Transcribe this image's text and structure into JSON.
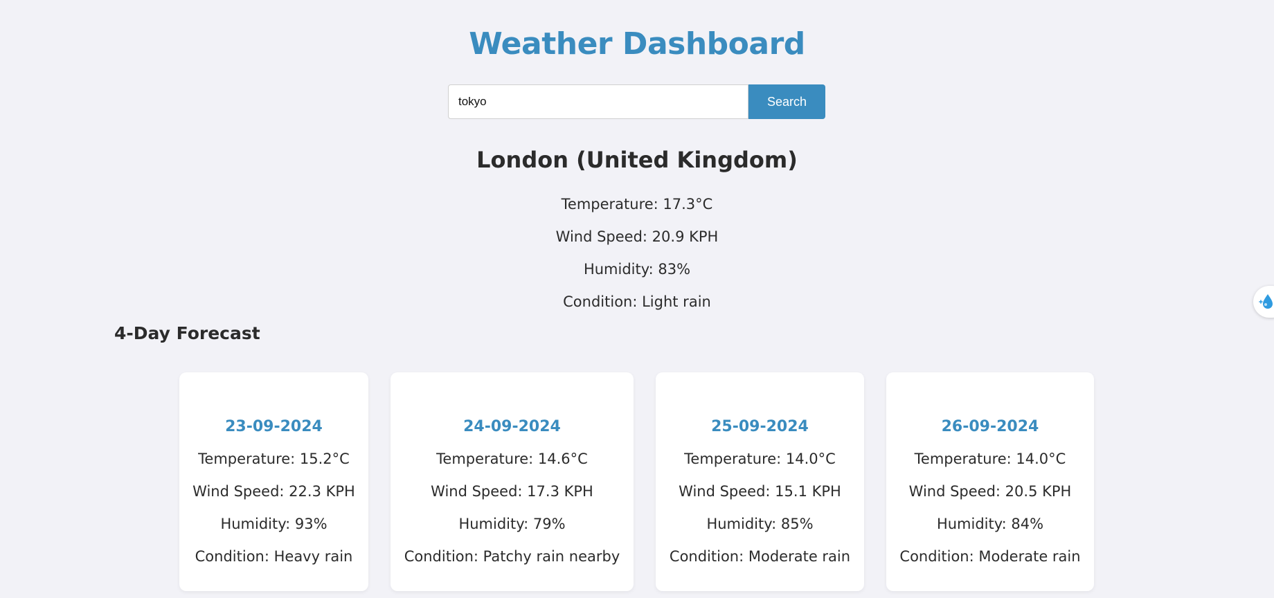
{
  "header": {
    "title": "Weather Dashboard"
  },
  "search": {
    "value": "tokyo",
    "button_label": "Search"
  },
  "current": {
    "city": "London (United Kingdom)",
    "temperature": "Temperature: 17.3°C",
    "wind": "Wind Speed: 20.9 KPH",
    "humidity": "Humidity: 83%",
    "condition": "Condition: Light rain"
  },
  "forecast": {
    "heading": "4-Day Forecast",
    "days": [
      {
        "date": "23-09-2024",
        "temperature": "Temperature: 15.2°C",
        "wind": "Wind Speed: 22.3 KPH",
        "humidity": "Humidity: 93%",
        "condition": "Condition: Heavy rain"
      },
      {
        "date": "24-09-2024",
        "temperature": "Temperature: 14.6°C",
        "wind": "Wind Speed: 17.3 KPH",
        "humidity": "Humidity: 79%",
        "condition": "Condition: Patchy rain nearby"
      },
      {
        "date": "25-09-2024",
        "temperature": "Temperature: 14.0°C",
        "wind": "Wind Speed: 15.1 KPH",
        "humidity": "Humidity: 85%",
        "condition": "Condition: Moderate rain"
      },
      {
        "date": "26-09-2024",
        "temperature": "Temperature: 14.0°C",
        "wind": "Wind Speed: 20.5 KPH",
        "humidity": "Humidity: 84%",
        "condition": "Condition: Moderate rain"
      }
    ]
  },
  "side_widget": {
    "icon": "water-drop-icon"
  },
  "colors": {
    "accent": "#3a8cbf",
    "background": "#f2f2f7",
    "text": "#2b2b2b"
  }
}
